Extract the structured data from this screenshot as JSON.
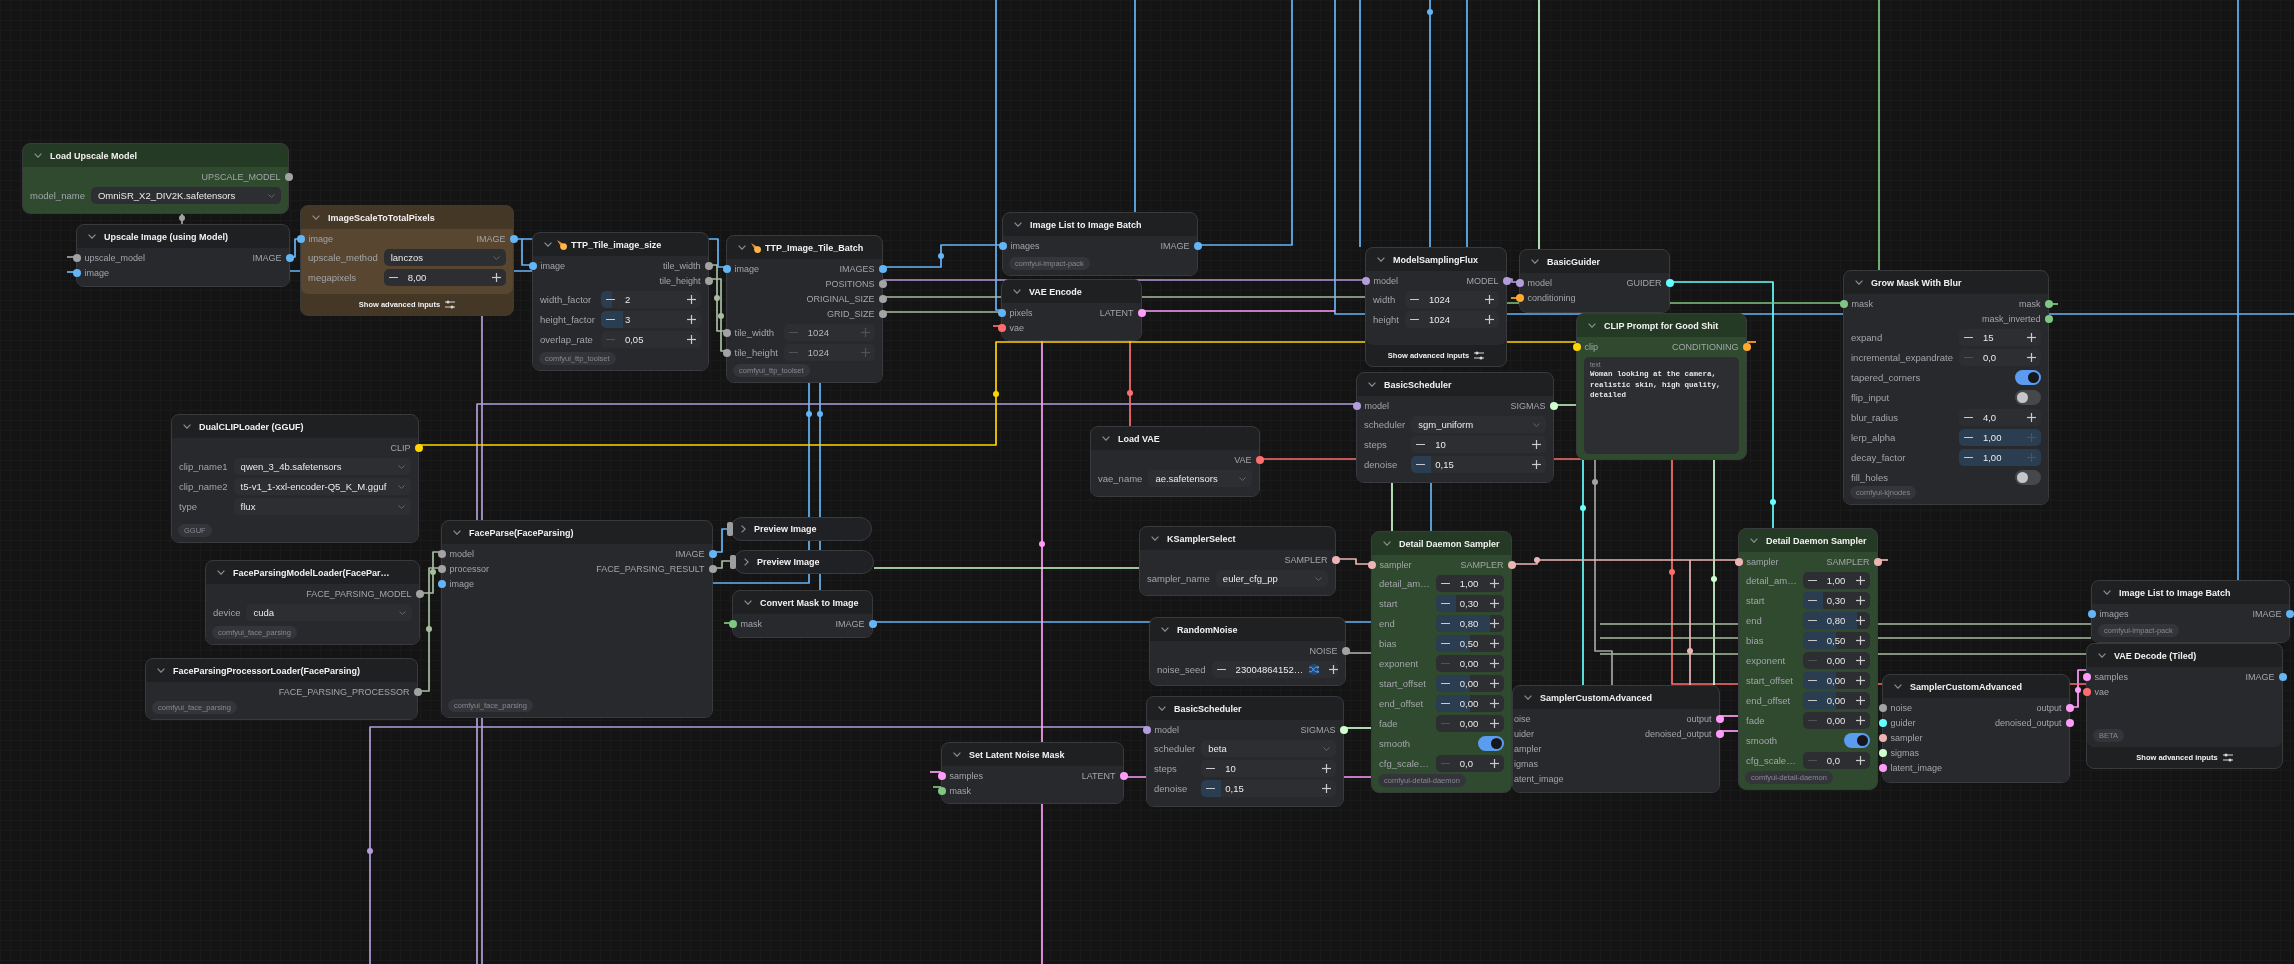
{
  "nodes": [
    {
      "title": "Load Upscale Model",
      "collapsed": false,
      "color": "#2f4a2e",
      "outputs": [
        {
          "label": "UPSCALE_MODEL",
          "color": "#a3a3a3"
        }
      ],
      "widgets": [
        {
          "kind": "combo",
          "label": "model_name",
          "value": "OmniSR_X2_DIV2K.safetensors"
        }
      ]
    },
    {
      "title": "Upscale Image (using Model)",
      "collapsed": false,
      "color": "#28292c",
      "inputs": [
        {
          "label": "upscale_model",
          "color": "#a3a3a3"
        },
        {
          "label": "image",
          "color": "#64b5f6"
        }
      ],
      "outputs": [
        {
          "label": "IMAGE",
          "color": "#64b5f6"
        }
      ]
    },
    {
      "title": "ImageScaleToTotalPixels",
      "collapsed": false,
      "color": "#584630",
      "inputs": [
        {
          "label": "image",
          "color": "#64b5f6"
        }
      ],
      "outputs": [
        {
          "label": "IMAGE",
          "color": "#64b5f6"
        }
      ],
      "widgets": [
        {
          "kind": "combo",
          "label": "upscale_method",
          "value": "lanczos"
        },
        {
          "kind": "number",
          "label": "megapixels",
          "value": "8,00",
          "dec_disabled": false,
          "inc_disabled": false
        }
      ],
      "advanced_button": "Show advanced inputs"
    },
    {
      "title": "TTP_Tile_image_size",
      "collapsed": false,
      "title_icon": true,
      "color": "#28292c",
      "inputs": [
        {
          "label": "image",
          "color": "#64b5f6"
        }
      ],
      "outputs": [
        {
          "label": "tile_width",
          "color": "#a3a3a3"
        },
        {
          "label": "tile_height",
          "color": "#a3a3a3"
        }
      ],
      "widgets": [
        {
          "kind": "number",
          "label": "width_factor",
          "value": "2",
          "level": 0.11,
          "dec_disabled": false,
          "inc_disabled": false
        },
        {
          "kind": "number",
          "label": "height_factor",
          "value": "3",
          "level": 0.22,
          "dec_disabled": false,
          "inc_disabled": false
        },
        {
          "kind": "number",
          "label": "overlap_rate",
          "value": "0,05",
          "dec_disabled": true,
          "inc_disabled": false
        }
      ],
      "badge": "comfyui_ttp_toolset"
    },
    {
      "title": "TTP_Image_Tile_Batch",
      "collapsed": false,
      "title_icon": true,
      "color": "#28292c",
      "inputs": [
        {
          "label": "image",
          "color": "#64b5f6"
        }
      ],
      "outputs": [
        {
          "label": "IMAGES",
          "color": "#64b5f6"
        },
        {
          "label": "POSITIONS",
          "color": "#a3a3a3"
        },
        {
          "label": "ORIGINAL_SIZE",
          "color": "#a3a3a3"
        },
        {
          "label": "GRID_SIZE",
          "color": "#a3a3a3"
        }
      ],
      "widgets": [
        {
          "kind": "number",
          "label": "tile_width",
          "value": "1024",
          "color": "#a3a3a3",
          "dec_disabled": true,
          "inc_disabled": true
        },
        {
          "kind": "number",
          "label": "tile_height",
          "value": "1024",
          "color": "#a3a3a3",
          "dec_disabled": true,
          "inc_disabled": true
        }
      ],
      "badge": "comfyui_ttp_toolset"
    },
    {
      "title": "Image List to Image Batch",
      "collapsed": false,
      "color": "#28292c",
      "inputs": [
        {
          "label": "images",
          "color": "#64b5f6"
        }
      ],
      "outputs": [
        {
          "label": "IMAGE",
          "color": "#64b5f6"
        }
      ],
      "badge": "comfyui-impact-pack"
    },
    {
      "title": "VAE Encode",
      "collapsed": false,
      "color": "#28292c",
      "inputs": [
        {
          "label": "pixels",
          "color": "#64b5f6"
        },
        {
          "label": "vae",
          "color": "#ff6e6e"
        }
      ],
      "outputs": [
        {
          "label": "LATENT",
          "color": "#ff9cf9"
        }
      ]
    },
    {
      "title": "DualCLIPLoader (GGUF)",
      "collapsed": false,
      "color": "#28292c",
      "outputs": [
        {
          "label": "CLIP",
          "color": "#ffd500"
        }
      ],
      "widgets": [
        {
          "kind": "combo",
          "label": "clip_name1",
          "value": "qwen_3_4b.safetensors"
        },
        {
          "kind": "combo",
          "label": "clip_name2",
          "value": "t5-v1_1-xxl-encoder-Q5_K_M.gguf"
        },
        {
          "kind": "combo",
          "label": "type",
          "value": "flux"
        }
      ],
      "badge": "GGUF"
    },
    {
      "title": "ModelSamplingFlux",
      "collapsed": false,
      "color": "#28292c",
      "inputs": [
        {
          "label": "model",
          "color": "#b39ddb"
        }
      ],
      "outputs": [
        {
          "label": "MODEL",
          "color": "#b39ddb"
        }
      ],
      "widgets": [
        {
          "kind": "number",
          "label": "width",
          "value": "1024",
          "dec_disabled": false,
          "inc_disabled": false
        },
        {
          "kind": "number",
          "label": "height",
          "value": "1024",
          "dec_disabled": false,
          "inc_disabled": false
        }
      ],
      "advanced_button": "Show advanced inputs"
    },
    {
      "title": "BasicGuider",
      "collapsed": false,
      "color": "#28292c",
      "inputs": [
        {
          "label": "model",
          "color": "#b39ddb"
        },
        {
          "label": "conditioning",
          "color": "#ffa931"
        }
      ],
      "outputs": [
        {
          "label": "GUIDER",
          "color": "#66ffff"
        }
      ]
    },
    {
      "title": "Load VAE",
      "collapsed": false,
      "color": "#28292c",
      "outputs": [
        {
          "label": "VAE",
          "color": "#ff6e6e"
        }
      ],
      "widgets": [
        {
          "kind": "combo",
          "label": "vae_name",
          "value": "ae.safetensors"
        }
      ]
    },
    {
      "title": "BasicScheduler",
      "collapsed": false,
      "color": "#28292c",
      "inputs": [
        {
          "label": "model",
          "color": "#b39ddb"
        }
      ],
      "outputs": [
        {
          "label": "SIGMAS",
          "color": "#cdffcd"
        }
      ],
      "widgets": [
        {
          "kind": "combo",
          "label": "scheduler",
          "value": "sgm_uniform"
        },
        {
          "kind": "number",
          "label": "steps",
          "value": "10",
          "dec_disabled": false,
          "inc_disabled": false
        },
        {
          "kind": "number",
          "label": "denoise",
          "value": "0,15",
          "level": 0.15,
          "dec_disabled": false,
          "inc_disabled": false
        }
      ]
    },
    {
      "title": "CLIP Prompt for Good Shit",
      "collapsed": false,
      "color": "#2f4a2e",
      "inputs": [
        {
          "label": "clip",
          "color": "#ffd500"
        }
      ],
      "outputs": [
        {
          "label": "CONDITIONING",
          "color": "#ffa931"
        }
      ],
      "widgets": [
        {
          "kind": "text",
          "label": "text",
          "value": "Woman looking at the camera, realistic skin, high quality, detailed"
        }
      ]
    },
    {
      "title": "Grow Mask With Blur",
      "collapsed": false,
      "color": "#28292c",
      "inputs": [
        {
          "label": "mask",
          "color": "#81c784"
        }
      ],
      "outputs": [
        {
          "label": "mask",
          "color": "#81c784"
        },
        {
          "label": "mask_inverted",
          "color": "#81c784"
        }
      ],
      "widgets": [
        {
          "kind": "number",
          "label": "expand",
          "value": "15",
          "dec_disabled": false,
          "inc_disabled": false
        },
        {
          "kind": "number",
          "label": "incremental_expandrate",
          "value": "0,0",
          "dec_disabled": true,
          "inc_disabled": false
        },
        {
          "kind": "toggle",
          "label": "tapered_corners",
          "on": true
        },
        {
          "kind": "toggle",
          "label": "flip_input",
          "on": false
        },
        {
          "kind": "number",
          "label": "blur_radius",
          "value": "4,0",
          "dec_disabled": false,
          "inc_disabled": false
        },
        {
          "kind": "number",
          "label": "lerp_alpha",
          "value": "1,00",
          "level": 1,
          "dec_disabled": false,
          "inc_disabled": true
        },
        {
          "kind": "number",
          "label": "decay_factor",
          "value": "1,00",
          "level": 1,
          "dec_disabled": false,
          "inc_disabled": true
        },
        {
          "kind": "toggle",
          "label": "fill_holes",
          "on": false
        }
      ],
      "badge": "comfyui-kjnodes"
    },
    {
      "title": "FaceParsingModelLoader(FacePar…",
      "collapsed": false,
      "color": "#28292c",
      "outputs": [
        {
          "label": "FACE_PARSING_MODEL",
          "color": "#a3a3a3"
        }
      ],
      "widgets": [
        {
          "kind": "combo",
          "label": "device",
          "value": "cuda"
        }
      ],
      "badge": "comfyui_face_parsing"
    },
    {
      "title": "FaceParsingProcessorLoader(FaceParsing)",
      "collapsed": false,
      "color": "#28292c",
      "outputs": [
        {
          "label": "FACE_PARSING_PROCESSOR",
          "color": "#a3a3a3"
        }
      ],
      "badge": "comfyui_face_parsing"
    },
    {
      "title": "FaceParse(FaceParsing)",
      "collapsed": false,
      "color": "#28292c",
      "inputs": [
        {
          "label": "model",
          "color": "#a3a3a3"
        },
        {
          "label": "processor",
          "color": "#a3a3a3"
        },
        {
          "label": "image",
          "color": "#64b5f6"
        }
      ],
      "outputs": [
        {
          "label": "IMAGE",
          "color": "#64b5f6"
        },
        {
          "label": "FACE_PARSING_RESULT",
          "color": "#a3a3a3"
        }
      ],
      "badge": "comfyui_face_parsing"
    },
    {
      "title": "Preview Image",
      "collapsed": true,
      "color": "#202124"
    },
    {
      "title": "Preview Image",
      "collapsed": true,
      "color": "#202124"
    },
    {
      "title": "Convert Mask to Image",
      "collapsed": false,
      "color": "#28292c",
      "inputs": [
        {
          "label": "mask",
          "color": "#81c784"
        }
      ],
      "outputs": [
        {
          "label": "IMAGE",
          "color": "#64b5f6"
        }
      ]
    },
    {
      "title": "KSamplerSelect",
      "collapsed": false,
      "color": "#28292c",
      "outputs": [
        {
          "label": "SAMPLER",
          "color": "#ecb4b4"
        }
      ],
      "widgets": [
        {
          "kind": "combo",
          "label": "sampler_name",
          "value": "euler_cfg_pp"
        }
      ]
    },
    {
      "title": "RandomNoise",
      "collapsed": false,
      "color": "#28292c",
      "outputs": [
        {
          "label": "NOISE",
          "color": "#a3a3a3"
        }
      ],
      "widgets": [
        {
          "kind": "seed",
          "label": "noise_seed",
          "value": "23004864152…",
          "dec_disabled": false,
          "inc_disabled": false
        }
      ]
    },
    {
      "title": "Set Latent Noise Mask",
      "collapsed": false,
      "color": "#28292c",
      "inputs": [
        {
          "label": "samples",
          "color": "#ff9cf9"
        },
        {
          "label": "mask",
          "color": "#81c784"
        }
      ],
      "outputs": [
        {
          "label": "LATENT",
          "color": "#ff9cf9"
        }
      ]
    },
    {
      "title": "BasicScheduler",
      "collapsed": false,
      "color": "#28292c",
      "inputs": [
        {
          "label": "model",
          "color": "#b39ddb"
        }
      ],
      "outputs": [
        {
          "label": "SIGMAS",
          "color": "#cdffcd"
        }
      ],
      "widgets": [
        {
          "kind": "combo",
          "label": "scheduler",
          "value": "beta"
        },
        {
          "kind": "number",
          "label": "steps",
          "value": "10",
          "dec_disabled": false,
          "inc_disabled": false
        },
        {
          "kind": "number",
          "label": "denoise",
          "value": "0,15",
          "level": 0.15,
          "dec_disabled": false,
          "inc_disabled": false
        }
      ]
    },
    {
      "title": "Detail Daemon Sampler",
      "collapsed": false,
      "color": "#2f4a2e",
      "inputs": [
        {
          "label": "sampler",
          "color": "#ecb4b4"
        }
      ],
      "outputs": [
        {
          "label": "SAMPLER",
          "color": "#ecb4b4"
        }
      ],
      "widgets": [
        {
          "kind": "number",
          "label": "detail_am…",
          "value": "1,00",
          "dec_disabled": false,
          "inc_disabled": false
        },
        {
          "kind": "number",
          "label": "start",
          "value": "0,30",
          "level": 0.3,
          "dec_disabled": false,
          "inc_disabled": false
        },
        {
          "kind": "number",
          "label": "end",
          "value": "0,80",
          "level": 0.8,
          "dec_disabled": false,
          "inc_disabled": false
        },
        {
          "kind": "number",
          "label": "bias",
          "value": "0,50",
          "level": 0.5,
          "dec_disabled": false,
          "inc_disabled": false
        },
        {
          "kind": "number",
          "label": "exponent",
          "value": "0,00",
          "dec_disabled": true,
          "inc_disabled": false
        },
        {
          "kind": "number",
          "label": "start_offset",
          "value": "0,00",
          "level": 0.5,
          "dec_disabled": false,
          "inc_disabled": false
        },
        {
          "kind": "number",
          "label": "end_offset",
          "value": "0,00",
          "level": 0.5,
          "dec_disabled": false,
          "inc_disabled": false
        },
        {
          "kind": "number",
          "label": "fade",
          "value": "0,00",
          "dec_disabled": true,
          "inc_disabled": false
        },
        {
          "kind": "toggle",
          "label": "smooth",
          "on": true
        },
        {
          "kind": "number",
          "label": "cfg_scale…",
          "value": "0,0",
          "dec_disabled": true,
          "inc_disabled": false
        }
      ],
      "badge": "comfyui-detail-daemon"
    },
    {
      "title": "SamplerCustomAdvanced",
      "collapsed": false,
      "color": "#28292c",
      "inputs": [
        {
          "label": "oise"
        },
        {
          "label": "uider"
        },
        {
          "label": "ampler"
        },
        {
          "label": "igmas"
        },
        {
          "label": "atent_image"
        }
      ],
      "outputs": [
        {
          "label": "output",
          "color": "#ff9cf9"
        },
        {
          "label": "denoised_output",
          "color": "#ff9cf9"
        }
      ]
    },
    {
      "title": "Detail Daemon Sampler",
      "collapsed": false,
      "color": "#2f4a2e",
      "inputs": [
        {
          "label": "sampler",
          "color": "#ecb4b4"
        }
      ],
      "outputs": [
        {
          "label": "SAMPLER",
          "color": "#ecb4b4"
        }
      ],
      "widgets": [
        {
          "kind": "number",
          "label": "detail_am…",
          "value": "1,00",
          "dec_disabled": false,
          "inc_disabled": false
        },
        {
          "kind": "number",
          "label": "start",
          "value": "0,30",
          "level": 0.3,
          "dec_disabled": false,
          "inc_disabled": false
        },
        {
          "kind": "number",
          "label": "end",
          "value": "0,80",
          "level": 0.8,
          "dec_disabled": false,
          "inc_disabled": false
        },
        {
          "kind": "number",
          "label": "bias",
          "value": "0,50",
          "level": 0.5,
          "dec_disabled": false,
          "inc_disabled": false
        },
        {
          "kind": "number",
          "label": "exponent",
          "value": "0,00",
          "dec_disabled": true,
          "inc_disabled": false
        },
        {
          "kind": "number",
          "label": "start_offset",
          "value": "0,00",
          "level": 0.5,
          "dec_disabled": false,
          "inc_disabled": false
        },
        {
          "kind": "number",
          "label": "end_offset",
          "value": "0,00",
          "level": 0.5,
          "dec_disabled": false,
          "inc_disabled": false
        },
        {
          "kind": "number",
          "label": "fade",
          "value": "0,00",
          "dec_disabled": true,
          "inc_disabled": false
        },
        {
          "kind": "toggle",
          "label": "smooth",
          "on": true
        },
        {
          "kind": "number",
          "label": "cfg_scale…",
          "value": "0,0",
          "dec_disabled": true,
          "inc_disabled": false
        }
      ],
      "badge": "comfyui-detail-daemon"
    },
    {
      "title": "SamplerCustomAdvanced",
      "collapsed": false,
      "color": "#28292c",
      "inputs": [
        {
          "label": "noise",
          "color": "#a3a3a3"
        },
        {
          "label": "guider",
          "color": "#66ffff"
        },
        {
          "label": "sampler",
          "color": "#ecb4b4"
        },
        {
          "label": "sigmas",
          "color": "#cdffcd"
        },
        {
          "label": "latent_image",
          "color": "#ff9cf9"
        }
      ],
      "outputs": [
        {
          "label": "output",
          "color": "#ff9cf9"
        },
        {
          "label": "denoised_output",
          "color": "#ff9cf9"
        }
      ]
    },
    {
      "title": "Image List to Image Batch",
      "collapsed": false,
      "color": "#28292c",
      "inputs": [
        {
          "label": "images",
          "color": "#64b5f6"
        }
      ],
      "outputs": [
        {
          "label": "IMAGE",
          "color": "#64b5f6"
        }
      ],
      "badge": "comfyui-impact-pack"
    },
    {
      "title": "VAE Decode (Tiled)",
      "collapsed": false,
      "color": "#28292c",
      "inputs": [
        {
          "label": "samples",
          "color": "#ff9cf9"
        },
        {
          "label": "vae",
          "color": "#ff6e6e"
        }
      ],
      "outputs": [
        {
          "label": "IMAGE",
          "color": "#64b5f6"
        }
      ],
      "badge": "BETA",
      "advanced_button": "Show advanced inputs"
    }
  ]
}
